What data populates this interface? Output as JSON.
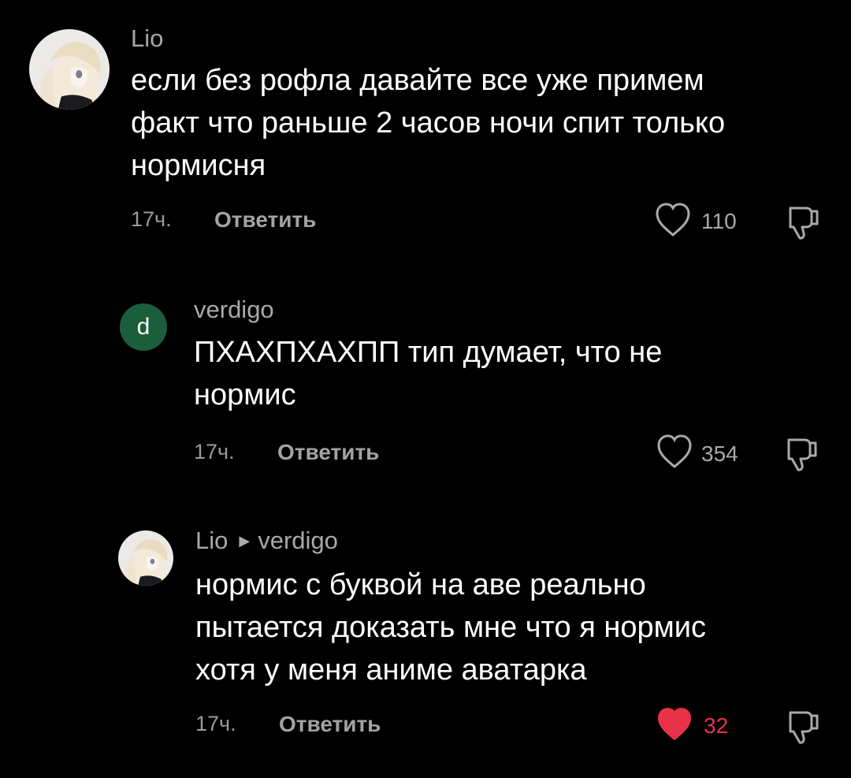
{
  "colors": {
    "background": "#000000",
    "text": "#ffffff",
    "muted": "#a9a9a9",
    "like_active": "#e8324a",
    "letter_avatar_bg": "#1b5e3c"
  },
  "comments": [
    {
      "author": "Lio",
      "avatar": "anime-girl-avatar",
      "lines": [
        "если без рофла давайте все уже примем",
        "факт что раньше 2 часов ночи спит только",
        "нормисня"
      ],
      "time": "17ч.",
      "reply_label": "Ответить",
      "likes": "110",
      "liked": false
    },
    {
      "author": "verdigo",
      "avatar_letter": "d",
      "lines": [
        "ПХАХПХАХПП тип думает, что не",
        "нормис"
      ],
      "time": "17ч.",
      "reply_label": "Ответить",
      "likes": "354",
      "liked": false
    },
    {
      "author": "Lio",
      "reply_to": "verdigo",
      "avatar": "anime-girl-avatar",
      "lines": [
        "нормис с буквой на аве реально",
        "пытается доказать мне что я нормис",
        "хотя у меня аниме аватарка"
      ],
      "time": "17ч.",
      "reply_label": "Ответить",
      "likes": "32",
      "liked": true
    }
  ]
}
